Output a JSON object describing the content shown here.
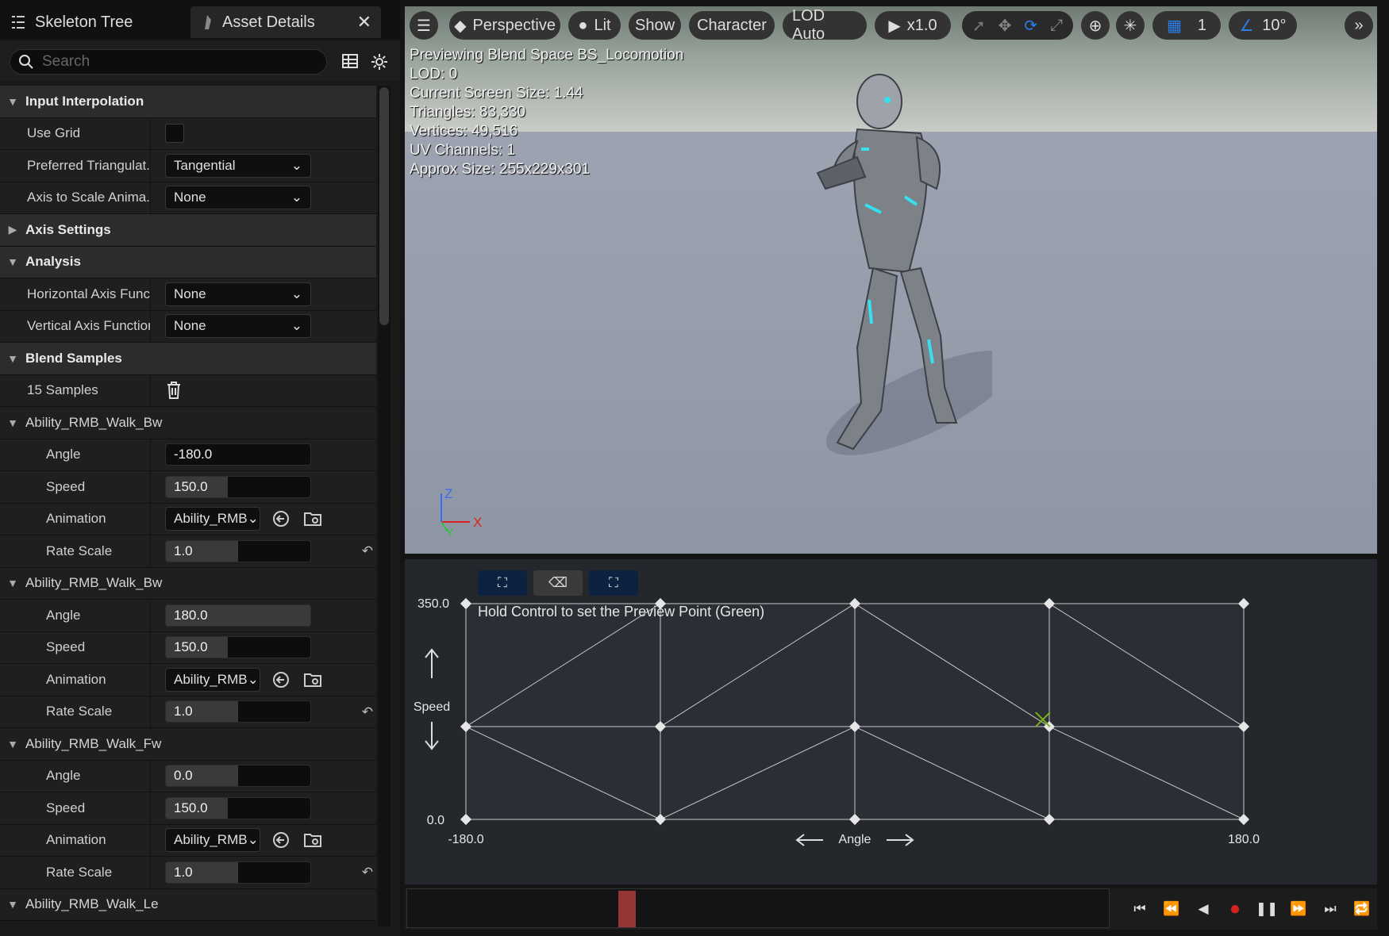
{
  "tabs": {
    "skeleton_tree": "Skeleton Tree",
    "asset_details": "Asset Details"
  },
  "search": {
    "placeholder": "Search"
  },
  "details": {
    "input_interpolation": {
      "header": "Input Interpolation",
      "use_grid_label": "Use Grid",
      "use_grid_checked": false,
      "preferred_tri_label": "Preferred Triangulat...",
      "preferred_tri_value": "Tangential",
      "axis_scale_label": "Axis to Scale Anima...",
      "axis_scale_value": "None"
    },
    "axis_settings": {
      "header": "Axis Settings"
    },
    "analysis": {
      "header": "Analysis",
      "horizontal_label": "Horizontal Axis Functi",
      "horizontal_value": "None",
      "vertical_label": "Vertical Axis Function",
      "vertical_value": "None"
    },
    "blend_samples": {
      "header": "Blend Samples",
      "count_label": "15 Samples"
    },
    "samples": [
      {
        "name": "Ability_RMB_Walk_Bw",
        "angle": "-180.0",
        "angle_fill": 0.0,
        "speed": "150.0",
        "speed_fill": 0.43,
        "animation": "Ability_RMB",
        "rate": "1.0",
        "rate_fill": 0.5
      },
      {
        "name": "Ability_RMB_Walk_Bw",
        "angle": "180.0",
        "angle_fill": 1.0,
        "speed": "150.0",
        "speed_fill": 0.43,
        "animation": "Ability_RMB",
        "rate": "1.0",
        "rate_fill": 0.5
      },
      {
        "name": "Ability_RMB_Walk_Fw",
        "angle": "0.0",
        "angle_fill": 0.5,
        "speed": "150.0",
        "speed_fill": 0.43,
        "animation": "Ability_RMB",
        "rate": "1.0",
        "rate_fill": 0.5
      }
    ],
    "labels": {
      "angle": "Angle",
      "speed": "Speed",
      "animation": "Animation",
      "rate_scale": "Rate Scale"
    },
    "last_sample_name": "Ability_RMB_Walk_Le"
  },
  "viewport": {
    "toolbar": {
      "perspective": "Perspective",
      "lit": "Lit",
      "show": "Show",
      "character": "Character",
      "lod": "LOD Auto",
      "play_speed": "x1.0",
      "grid_value": "1",
      "angle_snap": "10°"
    },
    "stats": [
      "Previewing Blend Space BS_Locomotion",
      "LOD: 0",
      "Current Screen Size: 1.44",
      "Triangles: 83,330",
      "Vertices: 49,516",
      "UV Channels: 1",
      "Approx Size: 255x229x301"
    ],
    "axis_labels": {
      "z": "Z",
      "x": "X",
      "y": "Y"
    }
  },
  "blendspace": {
    "hint": "Hold Control to set the Preview Point (Green)",
    "y_label": "Speed",
    "x_label": "Angle",
    "y_max_label": "350.0",
    "y_min_label": "0.0",
    "x_min_label": "-180.0",
    "x_max_label": "180.0",
    "preview_point": {
      "angle": 87,
      "speed": 162
    }
  },
  "timeline": {
    "position": 0.3
  },
  "colors": {
    "accent": "#2b7de9",
    "preview": "#7ab317",
    "marker": "#a03a3a"
  }
}
